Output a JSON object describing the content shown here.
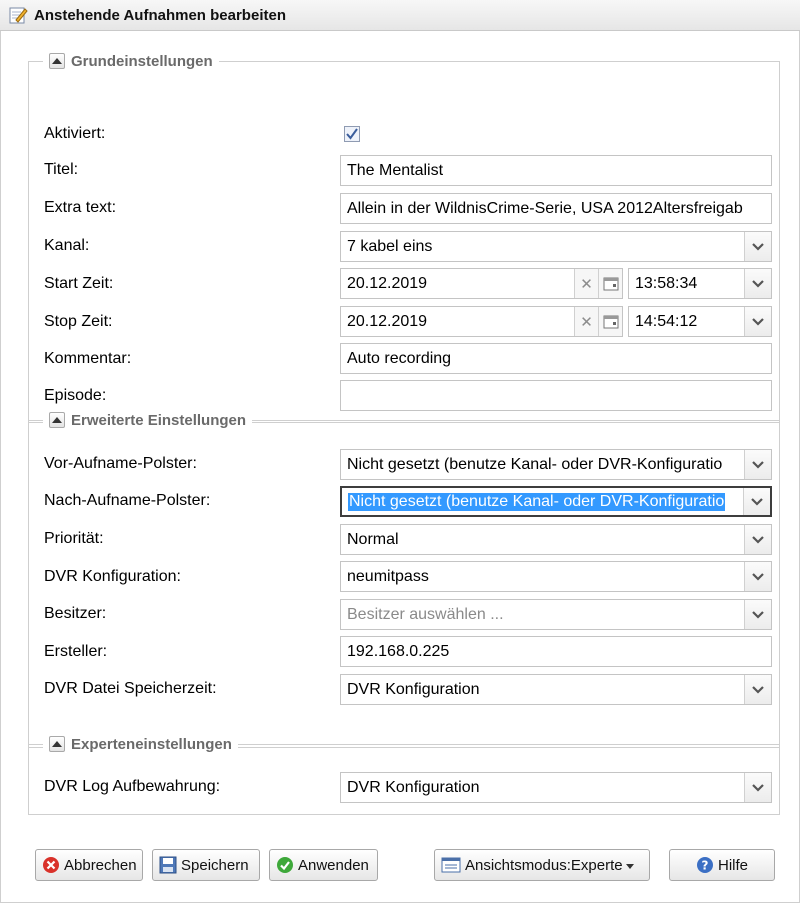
{
  "window": {
    "title": "Anstehende Aufnahmen bearbeiten"
  },
  "sections": {
    "basic": {
      "title": "Grundeinstellungen",
      "fields": {
        "enabled": {
          "label": "Aktiviert:",
          "checked": true
        },
        "title": {
          "label": "Titel:",
          "value": "The Mentalist"
        },
        "extra_text": {
          "label": "Extra text:",
          "value": "Allein in der WildnisCrime-Serie, USA 2012Altersfreigab"
        },
        "channel": {
          "label": "Kanal:",
          "value": "7 kabel eins"
        },
        "start": {
          "label": "Start Zeit:",
          "date": "20.12.2019",
          "time": "13:58:34"
        },
        "stop": {
          "label": "Stop Zeit:",
          "date": "20.12.2019",
          "time": "14:54:12"
        },
        "comment": {
          "label": "Kommentar:",
          "value": "Auto recording"
        },
        "episode": {
          "label": "Episode:",
          "value": ""
        }
      }
    },
    "advanced": {
      "title": "Erweiterte Einstellungen",
      "fields": {
        "pre_padding": {
          "label": "Vor-Aufname-Polster:",
          "value": "Nicht gesetzt (benutze Kanal- oder DVR-Konfiguratio"
        },
        "post_padding": {
          "label": "Nach-Aufname-Polster:",
          "value": "Nicht gesetzt (benutze Kanal- oder DVR-Konfiguratio"
        },
        "priority": {
          "label": "Priorität:",
          "value": "Normal"
        },
        "dvr_config": {
          "label": "DVR Konfiguration:",
          "value": "neumitpass"
        },
        "owner": {
          "label": "Besitzer:",
          "placeholder": "Besitzer auswählen ..."
        },
        "creator": {
          "label": "Ersteller:",
          "value": "192.168.0.225"
        },
        "retention": {
          "label": "DVR Datei Speicherzeit:",
          "value": "DVR Konfiguration"
        }
      }
    },
    "expert": {
      "title": "Experteneinstellungen",
      "fields": {
        "log_retention": {
          "label": "DVR Log Aufbewahrung:",
          "value": "DVR Konfiguration"
        }
      }
    }
  },
  "buttons": {
    "cancel": "Abbrechen",
    "save": "Speichern",
    "apply": "Anwenden",
    "view_mode": "Ansichtsmodus:Experte",
    "help": "Hilfe"
  }
}
